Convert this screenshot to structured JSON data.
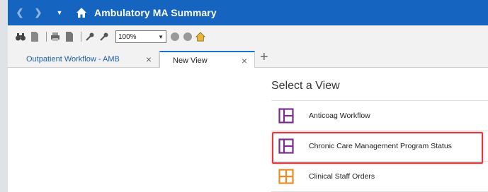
{
  "window": {
    "title": "Ambulatory MA Summary",
    "nav_back_icon": "back-arrow-icon",
    "nav_forward_icon": "forward-arrow-icon",
    "nav_dropdown_icon": "dropdown-icon",
    "home_icon": "home-icon",
    "accent_color": "#1565c0"
  },
  "toolbar": {
    "zoom_value": "100%",
    "icons": [
      "binoculars-icon",
      "document-icon",
      "print-icon",
      "print-preview-icon",
      "wrench-icon",
      "wrench-alt-icon",
      "circle-icon",
      "circle-icon",
      "home-icon"
    ]
  },
  "tabs": [
    {
      "label": "Outpatient Workflow - AMB",
      "active": false
    },
    {
      "label": "New View",
      "active": true
    }
  ],
  "add_tab_label": "+",
  "close_glyph": "×",
  "views": {
    "heading": "Select a View",
    "items": [
      {
        "label": "Anticoag Workflow",
        "icon": "layout-icon",
        "color": "#7b2d8b"
      },
      {
        "label": "Chronic Care Management Program Status",
        "icon": "layout-icon",
        "color": "#7b2d8b",
        "highlighted": true
      },
      {
        "label": "Clinical Staff Orders",
        "icon": "grid-icon",
        "color": "#f08a24"
      }
    ],
    "highlight_color": "#e0383a"
  }
}
